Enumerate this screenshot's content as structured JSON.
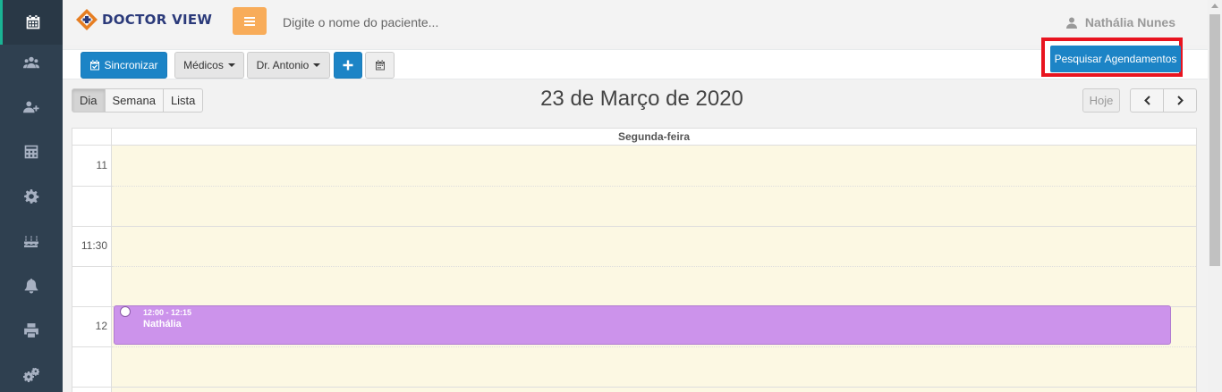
{
  "app": {
    "logo_text": "DOCTOR VIEW"
  },
  "header": {
    "search_placeholder": "Digite o nome do paciente...",
    "user_name": "Nathália Nunes"
  },
  "sidebar": {
    "items": [
      {
        "icon": "calendar-icon",
        "active": true
      },
      {
        "icon": "users-icon",
        "active": false
      },
      {
        "icon": "add-user-icon",
        "active": false
      },
      {
        "icon": "calculator-icon",
        "active": false
      },
      {
        "icon": "gear-icon",
        "active": false
      },
      {
        "icon": "birthday-cake-icon",
        "active": false
      },
      {
        "icon": "bell-icon",
        "active": false
      },
      {
        "icon": "printer-icon",
        "active": false
      },
      {
        "icon": "gears-icon",
        "active": false
      }
    ]
  },
  "toolbar": {
    "sync_label": "Sincronizar",
    "doctors_label": "Médicos",
    "doctor_selected": "Dr. Antonio",
    "search_appointments_label": "Pesquisar Agendamentos"
  },
  "calendar": {
    "views": [
      "Dia",
      "Semana",
      "Lista"
    ],
    "active_view": "Dia",
    "title": "23 de Março de 2020",
    "today_label": "Hoje",
    "day_header": "Segunda-feira",
    "time_labels": [
      "11",
      "11:30",
      "12"
    ],
    "event": {
      "time": "12:00 - 12:15",
      "title": "Nathália",
      "color": "#cc93eb"
    }
  },
  "colors": {
    "sidebar_bg": "#2f4050",
    "primary": "#1c84c6",
    "warning": "#f8ac59",
    "highlight_border": "#e8141f",
    "day_bg": "#fcf8e3"
  }
}
